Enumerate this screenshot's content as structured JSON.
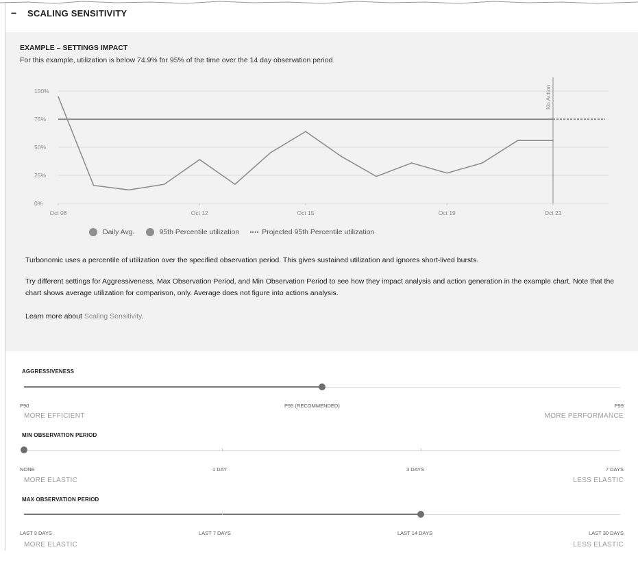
{
  "section": {
    "title": "SCALING SENSITIVITY",
    "collapse_symbol": "−"
  },
  "example": {
    "title": "EXAMPLE – SETTINGS IMPACT",
    "description": "For this example, utilization is below 74.9% for 95% of the time over the 14 day observation period"
  },
  "chart_data": {
    "type": "line",
    "x": [
      "Oct 08",
      "Oct 09",
      "Oct 10",
      "Oct 11",
      "Oct 12",
      "Oct 13",
      "Oct 14",
      "Oct 15",
      "Oct 16",
      "Oct 17",
      "Oct 18",
      "Oct 19",
      "Oct 20",
      "Oct 21",
      "Oct 22"
    ],
    "x_tick_labels": [
      "Oct 08",
      "Oct 12",
      "Oct 15",
      "Oct 19",
      "Oct 22"
    ],
    "y_tick_labels": [
      "0%",
      "25%",
      "50%",
      "75%",
      "100%"
    ],
    "ylim": [
      0,
      100
    ],
    "series": [
      {
        "name": "Daily Avg.",
        "values": [
          95,
          16,
          12,
          17,
          39,
          17,
          45,
          64,
          42,
          24,
          36,
          27,
          36,
          56,
          56
        ]
      }
    ],
    "percentile_line": {
      "name": "95th Percentile utilization",
      "value": 74.9
    },
    "projected_line": {
      "name": "Projected 95th Percentile utilization",
      "value": 74.9
    },
    "marker": {
      "label": "No Action",
      "at": "Oct 22"
    },
    "grid": true,
    "legend_position": "bottom-left"
  },
  "legend": {
    "daily_avg": "Daily Avg.",
    "percentile": "95th Percentile utilization",
    "projected": "Projected 95th Percentile utilization"
  },
  "paragraphs": {
    "p1": "Turbonomic uses a percentile of utilization over the specified observation period. This gives sustained utilization and ignores short-lived bursts.",
    "p2": "Try different settings for Aggressiveness, Max Observation Period, and Min Observation Period to see how they impact analysis and action generation in the example chart. Note that the chart shows average utilization for comparison, only. Average does not figure into actions analysis.",
    "p3_prefix": "Learn more about ",
    "p3_link": "Scaling Sensitivity",
    "p3_suffix": "."
  },
  "aggressiveness": {
    "title": "AGGRESSIVENESS",
    "stops": [
      "P90",
      "P95 (RECOMMENDED)",
      "P99"
    ],
    "selected": "P95 (RECOMMENDED)",
    "left_hint": "MORE EFFICIENT",
    "right_hint": "MORE PERFORMANCE"
  },
  "min_observation": {
    "title": "MIN OBSERVATION PERIOD",
    "stops": [
      "NONE",
      "1 DAY",
      "3 DAYS",
      "7 DAYS"
    ],
    "selected": "NONE",
    "left_hint": "MORE ELASTIC",
    "right_hint": "LESS ELASTIC"
  },
  "max_observation": {
    "title": "MAX OBSERVATION PERIOD",
    "stops": [
      "LAST 3 DAYS",
      "LAST 7 DAYS",
      "LAST 14 DAYS",
      "LAST 30 DAYS"
    ],
    "selected": "LAST 14 DAYS",
    "left_hint": "MORE ELASTIC",
    "right_hint": "LESS ELASTIC"
  },
  "colors": {
    "panel_bg": "#f2f2f2",
    "line": "#8f8f8f",
    "slider_fill": "#767676",
    "link": "#888888"
  }
}
